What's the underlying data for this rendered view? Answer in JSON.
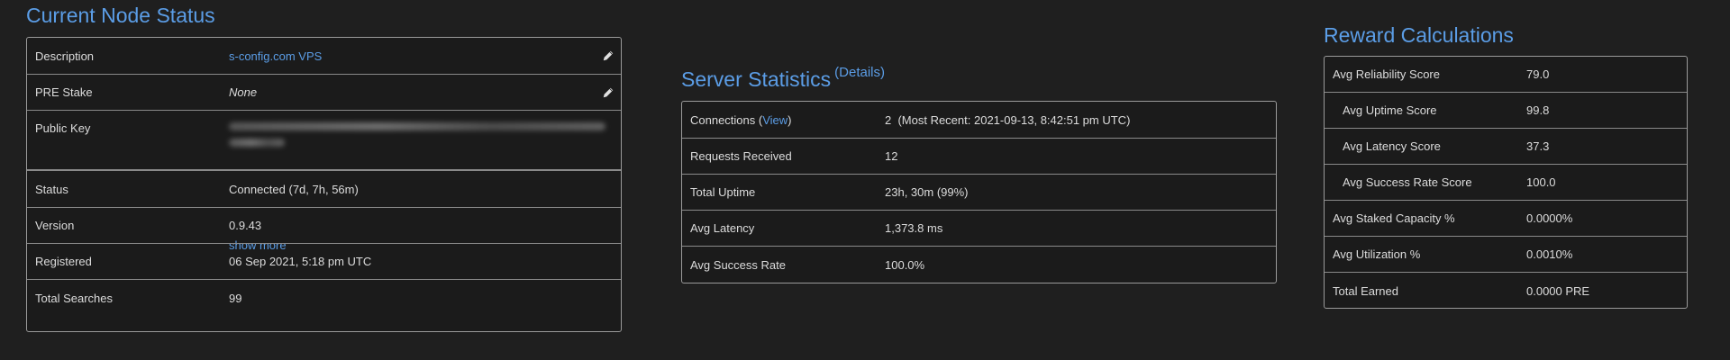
{
  "node_status": {
    "title": "Current Node Status",
    "rows": {
      "description": {
        "label": "Description",
        "value": "s-config.com VPS"
      },
      "pre_stake": {
        "label": "PRE Stake",
        "value": "None"
      },
      "public_key": {
        "label": "Public Key",
        "show_more": "show more"
      },
      "status": {
        "label": "Status",
        "value": "Connected (7d, 7h, 56m)"
      },
      "version": {
        "label": "Version",
        "value": "0.9.43"
      },
      "registered": {
        "label": "Registered",
        "value": "06 Sep 2021, 5:18 pm UTC"
      },
      "total_searches": {
        "label": "Total Searches",
        "value": "99"
      }
    }
  },
  "server_stats": {
    "title": "Server Statistics",
    "details_link": "(Details)",
    "rows": {
      "connections": {
        "label_prefix": "Connections (",
        "label_link": "View",
        "label_suffix": ")",
        "value": "2  (Most Recent: 2021-09-13, 8:42:51 pm UTC)"
      },
      "requests": {
        "label": "Requests Received",
        "value": "12"
      },
      "uptime": {
        "label": "Total Uptime",
        "value": "23h, 30m (99%)"
      },
      "latency": {
        "label": "Avg Latency",
        "value": "1,373.8 ms"
      },
      "success_rate": {
        "label": "Avg Success Rate",
        "value": "100.0%"
      }
    }
  },
  "rewards": {
    "title": "Reward Calculations",
    "rows": {
      "reliability": {
        "label": "Avg Reliability Score",
        "value": "79.0"
      },
      "uptime_score": {
        "label": "Avg Uptime Score",
        "value": "99.8"
      },
      "latency_score": {
        "label": "Avg Latency Score",
        "value": "37.3"
      },
      "success_score": {
        "label": "Avg Success Rate Score",
        "value": "100.0"
      },
      "staked_capacity": {
        "label": "Avg Staked Capacity %",
        "value": "0.0000%"
      },
      "utilization": {
        "label": "Avg Utilization %",
        "value": "0.0010%"
      },
      "total_earned": {
        "label": "Total Earned",
        "value": "0.0000 PRE"
      }
    }
  },
  "colors": {
    "background": "#1f1f1f",
    "accent": "#5b9de6",
    "border": "#9a9a9a"
  },
  "icons": {
    "edit": "pencil-icon"
  }
}
